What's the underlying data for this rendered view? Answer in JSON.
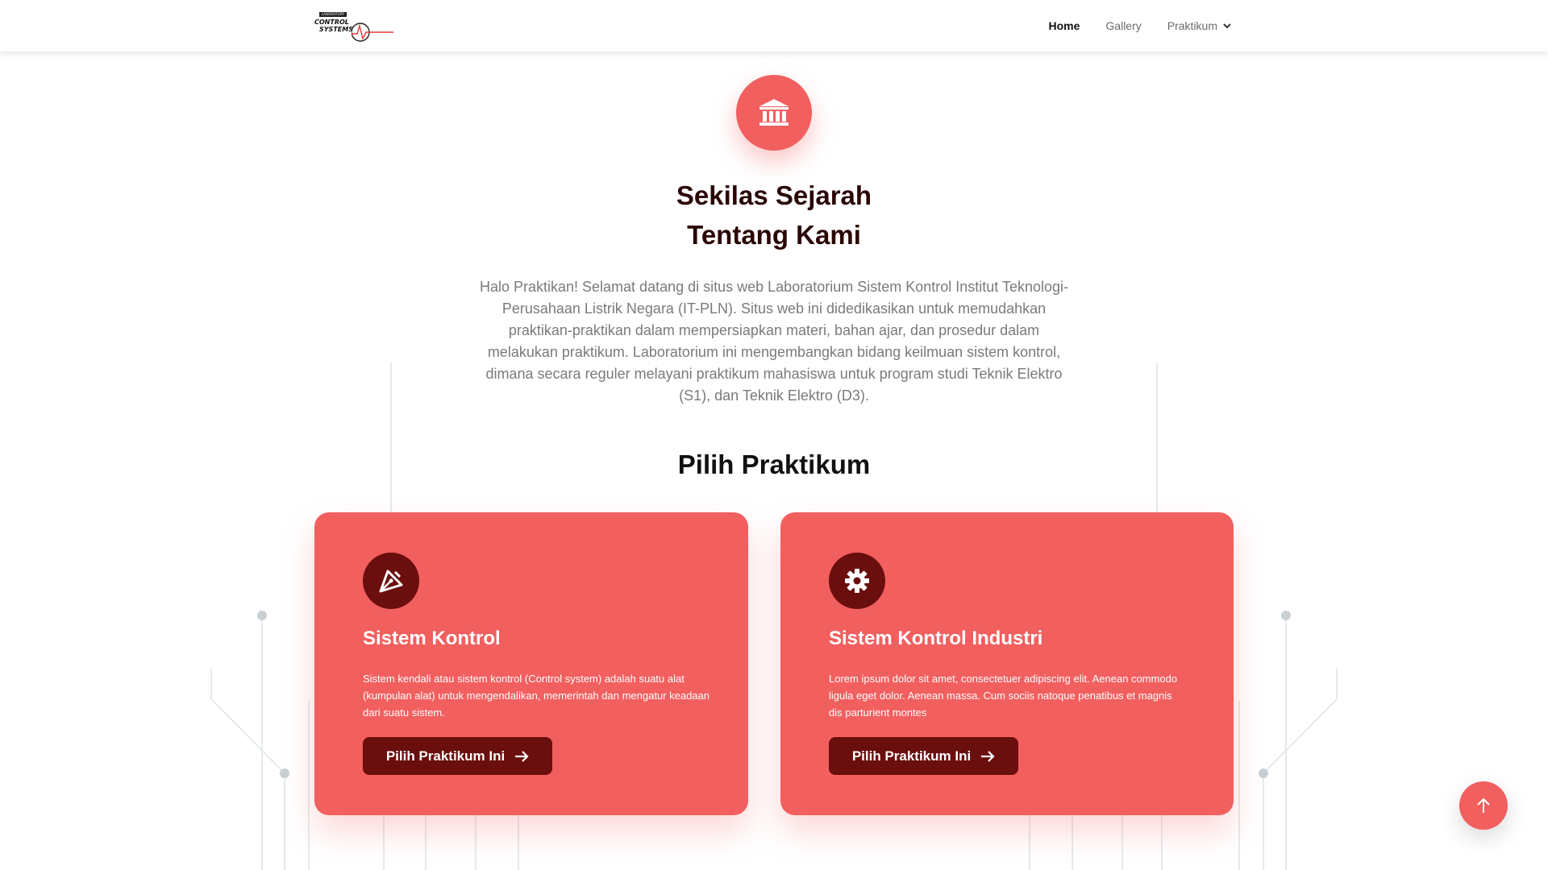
{
  "header": {
    "logo": {
      "tag": "LABORATORY",
      "line1": "CONTROL",
      "line2": "SYSTEMS"
    },
    "nav": [
      {
        "label": "Home",
        "active": true
      },
      {
        "label": "Gallery",
        "active": false
      },
      {
        "label": "Praktikum",
        "active": false,
        "icon": "chevron-down-icon"
      }
    ]
  },
  "hero": {
    "icon": "institution-icon",
    "title_line1": "Sekilas Sejarah",
    "title_line2": "Tentang Kami",
    "description": "Halo Praktikan! Selamat datang di situs web Laboratorium Sistem Kontrol Institut Teknologi-Perusahaan Listrik Negara (IT-PLN). Situs web ini didedikasikan untuk memudahkan praktikan-praktikan dalam mempersiapkan materi, bahan ajar, dan prosedur dalam melakukan praktikum. Laboratorium ini mengembangkan bidang keilmuan sistem kontrol, dimana secara reguler melayani praktikum mahasiswa untuk program studi Teknik Elektro (S1), dan Teknik Elektro (D3)."
  },
  "praktikum": {
    "title": "Pilih Praktikum",
    "cards": [
      {
        "icon": "pen-tool-icon",
        "title": "Sistem Kontrol",
        "text": "Sistem kendali atau sistem kontrol (Control system) adalah suatu alat (kumpulan alat) untuk mengendalikan, memerintah dan mengatur keadaan dari suatu sistem.",
        "button": "Pilih Praktikum Ini"
      },
      {
        "icon": "gear-icon",
        "title": "Sistem Kontrol Industri",
        "text": "Lorem ipsum dolor sit amet, consectetuer adipiscing elit. Aenean commodo ligula eget dolor. Aenean massa. Cum sociis natoque penatibus et magnis dis parturient montes",
        "button": "Pilih Praktikum Ini"
      }
    ]
  },
  "colors": {
    "accent": "#f25f5f",
    "dark_red": "#6b0e0e",
    "title": "#2b0606"
  },
  "scroll_top": {
    "icon": "arrow-up-icon"
  }
}
